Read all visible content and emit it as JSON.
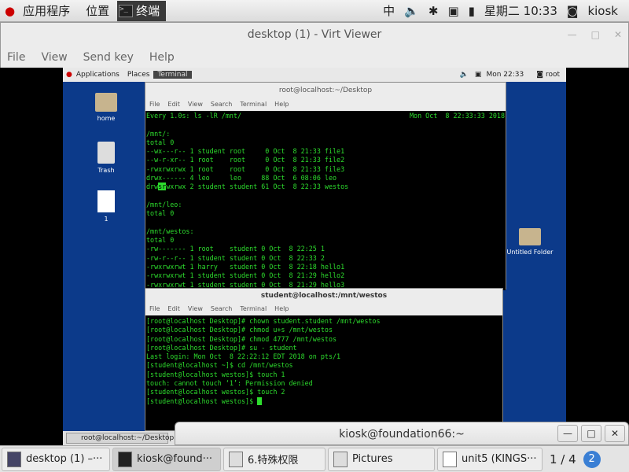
{
  "topbar": {
    "applications": "应用程序",
    "places": "位置",
    "terminal": "终端",
    "input_method": "中",
    "clock": "星期二 10:33",
    "user": "kiosk"
  },
  "virt_viewer": {
    "title": "desktop (1) - Virt Viewer",
    "menu": [
      "File",
      "View",
      "Send key",
      "Help"
    ]
  },
  "vm": {
    "panel": {
      "applications": "Applications",
      "places": "Places",
      "terminal": "Terminal",
      "clock": "Mon 22:33",
      "user": "root"
    },
    "desktop_icons": [
      "home",
      "Trash",
      "1",
      "Untitled Folder"
    ],
    "bottom_task": "root@localhost:~/Desktop",
    "term1": {
      "title": "root@localhost:~/Desktop",
      "menu": [
        "File",
        "Edit",
        "View",
        "Search",
        "Terminal",
        "Help"
      ],
      "header_left": "Every 1.0s: ls -lR /mnt/",
      "header_right": "Mon Oct  8 22:33:33 2018",
      "lines_a": [
        "",
        "/mnt/:",
        "total 0",
        "--wx---r-- 1 student root     0 Oct  8 21:33 file1",
        "--w-r-xr-- 1 root    root     0 Oct  8 21:33 file2",
        "-rwxrwxrwx 1 root    root     0 Oct  8 21:33 file3",
        "drwx------ 4 leo     leo     88 Oct  6 08:06 leo"
      ],
      "hl_pre": "drw",
      "hl_mark": "sr",
      "hl_post": "wxrwx 2 student student 61 Oct  8 22:33 westos",
      "lines_b": [
        "",
        "/mnt/leo:",
        "total 0",
        "",
        "/mnt/westos:",
        "total 0",
        "-rw------- 1 root    student 0 Oct  8 22:25 1",
        "-rw-r--r-- 1 student student 0 Oct  8 22:33 2",
        "-rwxrwxrwt 1 harry   student 0 Oct  8 22:18 hello1",
        "-rwxrwxrwt 1 student student 0 Oct  8 21:29 hello2",
        "-rwxrwxrwt 1 student student 0 Oct  8 21:29 hello3"
      ]
    },
    "term2": {
      "title": "student@localhost:/mnt/westos",
      "menu": [
        "File",
        "Edit",
        "View",
        "Search",
        "Terminal",
        "Help"
      ],
      "lines": [
        "[root@localhost Desktop]# chown student.student /mnt/westos",
        "[root@localhost Desktop]# chmod u+s /mnt/westos",
        "[root@localhost Desktop]# chmod 4777 /mnt/westos",
        "[root@localhost Desktop]# su - student",
        "Last login: Mon Oct  8 22:22:12 EDT 2018 on pts/1",
        "[student@localhost ~]$ cd /mnt/westos",
        "[student@localhost westos]$ touch 1",
        "touch: cannot touch ‘1’: Permission denied",
        "[student@localhost westos]$ touch 2"
      ],
      "prompt": "[student@localhost westos]$ "
    }
  },
  "host_window": {
    "title": "kiosk@foundation66:~"
  },
  "taskbar": {
    "items": [
      "desktop (1) –···",
      "kiosk@found···",
      "6.特殊权限",
      "Pictures",
      "unit5 (KINGS···"
    ],
    "workspace": "1 / 4",
    "badge": "2"
  },
  "colors": {
    "terminal_text": "#2ddc2d",
    "vm_desktop": "#0c3a8a"
  }
}
